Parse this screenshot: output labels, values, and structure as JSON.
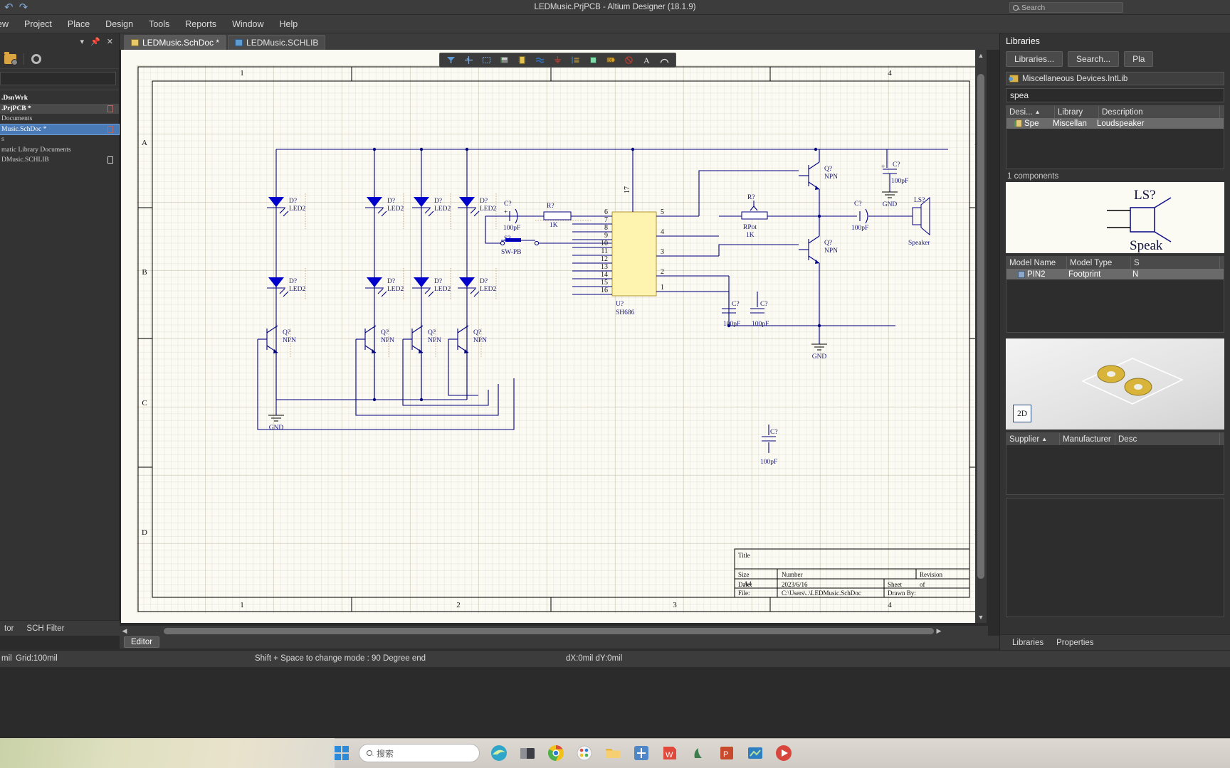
{
  "window": {
    "title": "LEDMusic.PrjPCB  - Altium Designer (18.1.9)",
    "search_placeholder": "Search",
    "back_icon": "back-arrow-icon",
    "forward_icon": "forward-arrow-icon"
  },
  "menu": {
    "items": [
      {
        "label": "ew",
        "accel": ""
      },
      {
        "label": "Project",
        "accel": "j"
      },
      {
        "label": "Place",
        "accel": "P"
      },
      {
        "label": "Design",
        "accel": "D"
      },
      {
        "label": "Tools",
        "accel": "T"
      },
      {
        "label": "Reports",
        "accel": "R"
      },
      {
        "label": "Window",
        "accel": "W"
      },
      {
        "label": "Help",
        "accel": "H"
      }
    ]
  },
  "project_panel": {
    "header_icons": [
      "dropdown-caret-icon",
      "pin-icon",
      "close-icon"
    ],
    "toolbar_icons": [
      "open-project-icon",
      "settings-gear-icon"
    ],
    "search_value": "",
    "tree": [
      {
        "label": ".DsnWrk",
        "bold": true,
        "icon": "",
        "state": "normal"
      },
      {
        "label": ".PrjPCB *",
        "bold": true,
        "icon": "doc-red-icon",
        "state": "highlight"
      },
      {
        "label": " Documents",
        "bold": false,
        "icon": "",
        "state": "normal"
      },
      {
        "label": "Music.SchDoc *",
        "bold": false,
        "icon": "doc-red-icon",
        "state": "selected"
      },
      {
        "label": "s",
        "bold": false,
        "icon": "",
        "state": "normal"
      },
      {
        "label": "matic Library Documents",
        "bold": false,
        "icon": "",
        "state": "normal"
      },
      {
        "label": "DMusic.SCHLIB",
        "bold": false,
        "icon": "doc-plain-icon",
        "state": "normal"
      }
    ],
    "bottom_tabs": [
      "tor",
      "SCH Filter"
    ]
  },
  "doc_tabs": [
    {
      "label": "LEDMusic.SchDoc *",
      "icon": "schematic-doc-icon",
      "active": true
    },
    {
      "label": "LEDMusic.SCHLIB",
      "icon": "schematic-lib-icon",
      "active": false
    }
  ],
  "schematic_toolbar": {
    "icons": [
      "wire-tool-icon",
      "bus-tool-icon",
      "bus-entry-icon",
      "net-label-icon",
      "gnd-power-port-icon",
      "part-icon",
      "signal-harness-icon",
      "power-port-icon",
      "sheet-symbol-icon",
      "device-sheet-icon",
      "port-icon",
      "text-string-icon",
      "no-erc-icon"
    ]
  },
  "sheet": {
    "zone_cols_top": [
      "1",
      "",
      "",
      "4"
    ],
    "zone_cols_bottom": [
      "1",
      "2",
      "3",
      "4"
    ],
    "zone_rows": [
      "A",
      "B",
      "C",
      "D"
    ],
    "title_block": {
      "title_label": "Title",
      "title_value": "",
      "size_label": "Size",
      "size_value": "A4",
      "number_label": "Number",
      "number_value": "",
      "revision_label": "Revision",
      "revision_value": "",
      "date_label": "Date:",
      "date_value": "2023/6/16",
      "sheet_label": "Sheet",
      "sheet_of": "of",
      "file_label": "File:",
      "file_value": "C:\\Users\\..\\LEDMusic.SchDoc",
      "drawn_label": "Drawn By:"
    },
    "components": {
      "leds": {
        "designator": "D?",
        "comment": "LED2",
        "count": 8
      },
      "transistors": {
        "designator": "Q?",
        "comment": "NPN",
        "count": 6
      },
      "caps": {
        "designator": "C?",
        "comment": "100pF"
      },
      "resistor_r": {
        "designator": "R?",
        "comment": "1K"
      },
      "resistor_pot": {
        "designator": "R?",
        "comment": "RPot",
        "value": "1K"
      },
      "switch": {
        "designator": "S?",
        "comment": "SW-PB"
      },
      "speaker": {
        "designator": "LS?",
        "comment": "Speaker"
      },
      "ic": {
        "designator": "U?",
        "comment": "SH686",
        "left_pins": [
          "6",
          "7",
          "8",
          "9",
          "10",
          "11",
          "12",
          "13",
          "14",
          "15",
          "16"
        ],
        "right_pins": [
          "5",
          "4",
          "3",
          "2",
          "1"
        ],
        "top_pin": "17"
      },
      "gnd_label": "GND"
    }
  },
  "editor_bar": {
    "tab_label": "Editor"
  },
  "status_bar": {
    "units": "mil",
    "grid": "Grid:100mil",
    "hint": "Shift + Space to change mode : 90 Degree end",
    "coords": "dX:0mil dY:0mil"
  },
  "libraries_panel": {
    "title": "Libraries",
    "buttons": [
      "Libraries...",
      "Search...",
      "Pla"
    ],
    "selected_library": "Miscellaneous Devices.IntLib",
    "filter_value": "spea",
    "results_headers": [
      "Desi...",
      "Library",
      "Description"
    ],
    "results_rows": [
      {
        "designator": "Spe",
        "library": "Miscellan",
        "description": "Loudspeaker"
      }
    ],
    "count_text": "1 components",
    "symbol_preview": {
      "designator": "LS?",
      "comment": "Speak"
    },
    "models_headers": [
      "Model Name",
      "Model Type",
      "S"
    ],
    "models_rows": [
      {
        "name": "PIN2",
        "type": "Footprint",
        "source": "N"
      }
    ],
    "preview_3d_button": "2D",
    "supplier_headers": [
      "Supplier",
      "Manufacturer",
      "Desc"
    ],
    "supplier_rows": [],
    "bottom_tabs": [
      "Libraries",
      "Properties"
    ]
  },
  "taskbar": {
    "search_placeholder": "搜索",
    "icons": [
      "windows-start-icon",
      "edge-browser-icon",
      "file-explorer-icon",
      "chrome-icon",
      "paint-icon",
      "folder-icon",
      "altium-icon",
      "wps-icon",
      "app-icon",
      "powerpoint-icon",
      "teams-icon",
      "media-player-icon"
    ]
  },
  "colors": {
    "accent": "#4a7ab5",
    "led_blue": "#0000cc",
    "ic_yellow": "#fff3b0",
    "sheet_bg": "#fbfaf3",
    "panel_bg": "#333333"
  }
}
